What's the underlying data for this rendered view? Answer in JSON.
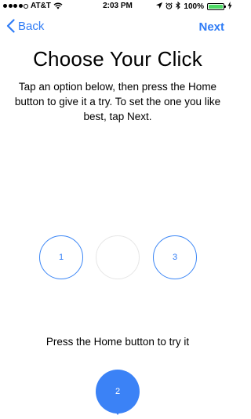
{
  "status_bar": {
    "carrier": "AT&T",
    "time": "2:03 PM",
    "battery": "100%"
  },
  "nav": {
    "back_label": "Back",
    "next_label": "Next"
  },
  "title": "Choose Your Click",
  "instructions": "Tap an option below, then press the Home button to give it a try. To set the one you like best, tap Next.",
  "options": [
    {
      "label": "1",
      "state": "available"
    },
    {
      "label": "",
      "state": "selected"
    },
    {
      "label": "3",
      "state": "available"
    }
  ],
  "hint": "Press the Home button to try it",
  "home_indicator": {
    "label": "2"
  },
  "colors": {
    "accent": "#2f7cf6",
    "pin": "#3b82f6",
    "battery": "#4cd964"
  }
}
